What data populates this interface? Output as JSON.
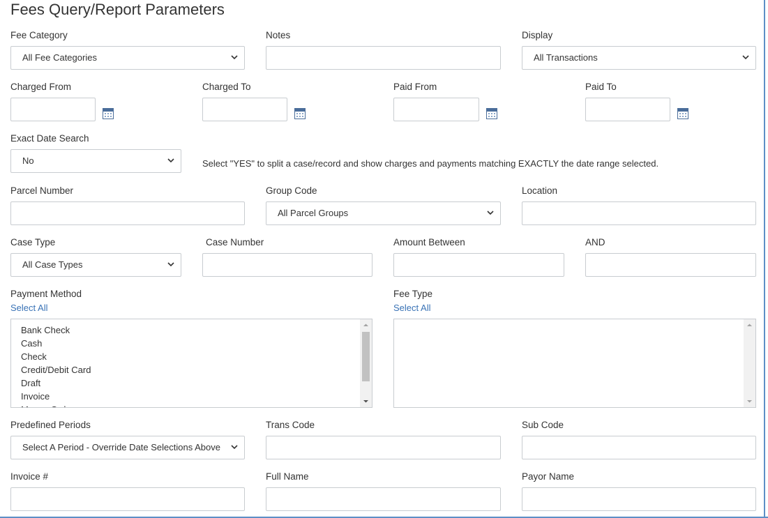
{
  "title": "Fees Query/Report Parameters",
  "fee_category": {
    "label": "Fee Category",
    "value": "All Fee Categories"
  },
  "notes": {
    "label": "Notes",
    "value": ""
  },
  "display": {
    "label": "Display",
    "value": "All Transactions"
  },
  "charged_from": {
    "label": "Charged From",
    "value": ""
  },
  "charged_to": {
    "label": "Charged To",
    "value": ""
  },
  "paid_from": {
    "label": "Paid From",
    "value": ""
  },
  "paid_to": {
    "label": "Paid To",
    "value": ""
  },
  "exact_date_search": {
    "label": "Exact Date Search",
    "value": "No",
    "help": "Select \"YES\" to split a case/record and show charges and payments matching EXACTLY the date range selected."
  },
  "parcel_number": {
    "label": "Parcel Number",
    "value": ""
  },
  "group_code": {
    "label": "Group Code",
    "value": "All Parcel Groups"
  },
  "location": {
    "label": "Location",
    "value": ""
  },
  "case_type": {
    "label": "Case Type",
    "value": "All Case Types"
  },
  "case_number": {
    "label": "Case Number",
    "value": ""
  },
  "amount_between": {
    "label": "Amount Between",
    "value": ""
  },
  "amount_and": {
    "label": "AND",
    "value": ""
  },
  "payment_method": {
    "label": "Payment Method",
    "select_all": "Select All",
    "options": [
      "Bank Check",
      "Cash",
      "Check",
      "Credit/Debit Card",
      "Draft",
      "Invoice",
      "Money Order"
    ]
  },
  "fee_type": {
    "label": "Fee Type",
    "select_all": "Select All",
    "options": []
  },
  "predefined_periods": {
    "label": "Predefined Periods",
    "value": "Select A Period - Override Date Selections Above"
  },
  "trans_code": {
    "label": "Trans Code",
    "value": ""
  },
  "sub_code": {
    "label": "Sub Code",
    "value": ""
  },
  "invoice_no": {
    "label": "Invoice #",
    "value": ""
  },
  "full_name": {
    "label": "Full Name",
    "value": ""
  },
  "payor_name": {
    "label": "Payor Name",
    "value": ""
  },
  "colors": {
    "link": "#3a73b6",
    "frame": "#5d8fc6",
    "border": "#c8ccd0"
  }
}
